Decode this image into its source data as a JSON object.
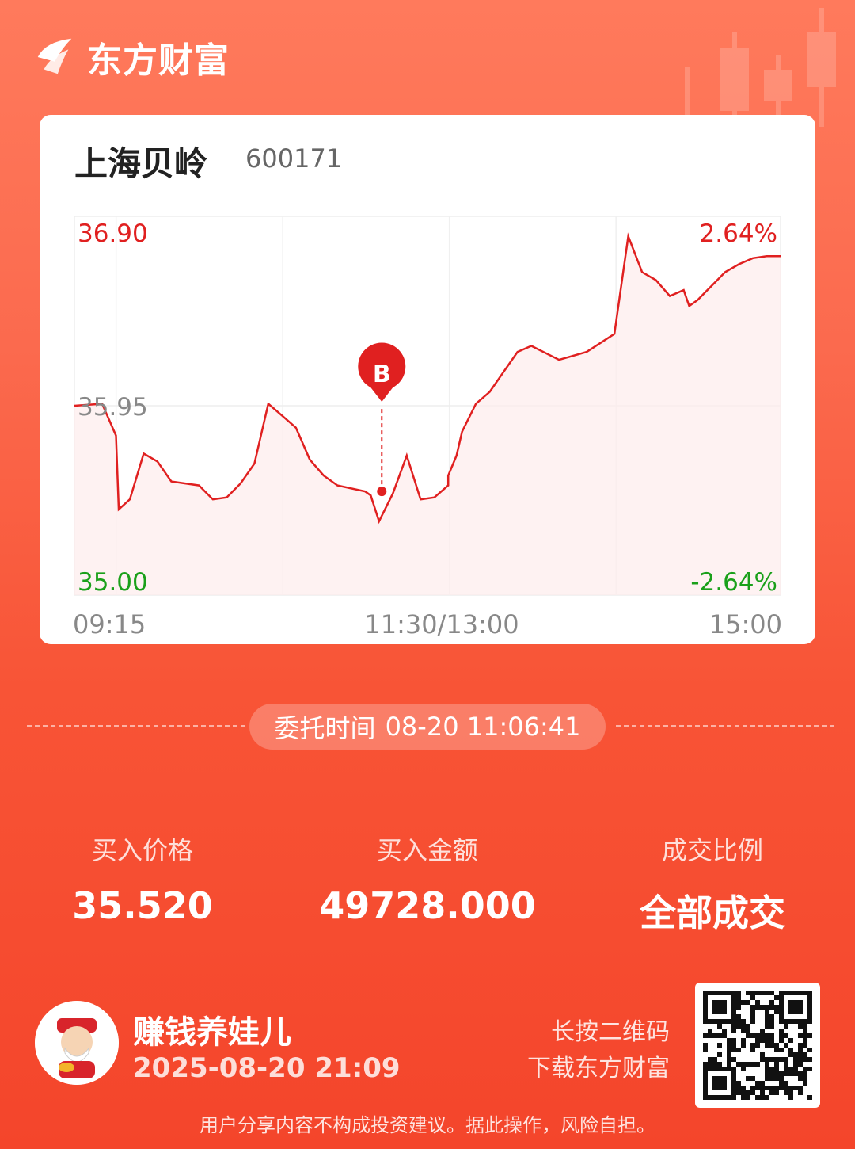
{
  "brand": {
    "name": "东方财富"
  },
  "stock": {
    "name": "上海贝岭",
    "code": "600171"
  },
  "chart_data": {
    "type": "line",
    "title": "",
    "x_tick_labels": [
      "09:15",
      "11:30/13:00",
      "15:00"
    ],
    "y_left_labels": [
      "36.90",
      "35.95",
      "35.00"
    ],
    "y_right_labels": [
      "2.64%",
      "-2.64%"
    ],
    "ylim": [
      35.0,
      36.9
    ],
    "reference_price": 35.95,
    "grid": true,
    "series": [
      {
        "x": [
          "09:15",
          "09:25",
          "09:30",
          "09:31",
          "09:35",
          "09:40",
          "09:45",
          "09:50",
          "10:00",
          "10:05",
          "10:10",
          "10:15",
          "10:20",
          "10:25",
          "10:30",
          "10:35",
          "10:40",
          "10:45",
          "10:50",
          "11:00",
          "11:02",
          "11:05",
          "11:10",
          "11:15",
          "11:20",
          "11:25",
          "11:30",
          "13:00",
          "13:03",
          "13:05",
          "13:10",
          "13:15",
          "13:20",
          "13:25",
          "13:30",
          "13:40",
          "13:50",
          "14:00",
          "14:05",
          "14:10",
          "14:15",
          "14:20",
          "14:25",
          "14:27",
          "14:30",
          "14:35",
          "14:40",
          "14:45",
          "14:50",
          "14:55",
          "15:00"
        ],
        "values": [
          35.95,
          35.96,
          35.8,
          35.43,
          35.48,
          35.71,
          35.67,
          35.57,
          35.55,
          35.48,
          35.49,
          35.56,
          35.66,
          35.96,
          35.9,
          35.84,
          35.68,
          35.6,
          35.55,
          35.52,
          35.5,
          35.37,
          35.51,
          35.7,
          35.48,
          35.49,
          35.55,
          35.6,
          35.7,
          35.82,
          35.96,
          36.02,
          36.12,
          36.22,
          36.25,
          36.18,
          36.22,
          36.31,
          36.8,
          36.62,
          36.58,
          36.5,
          36.53,
          36.45,
          36.48,
          36.55,
          36.62,
          36.66,
          36.69,
          36.7,
          36.7
        ]
      }
    ],
    "buy_marker": {
      "label": "B",
      "time": "11:06",
      "price": 35.52
    }
  },
  "order": {
    "time_label": "委托时间",
    "time_value": "08-20 11:06:41"
  },
  "stats": [
    {
      "label": "买入价格",
      "value": "35.520"
    },
    {
      "label": "买入金额",
      "value": "49728.000"
    },
    {
      "label": "成交比例",
      "value": "全部成交"
    }
  ],
  "user": {
    "name": "赚钱养娃儿",
    "datetime": "2025-08-20 21:09"
  },
  "qr_hint": {
    "line1": "长按二维码",
    "line2": "下载东方财富"
  },
  "disclaimer": "用户分享内容不构成投资建议。据此操作，风险自担。",
  "colors": {
    "up": "#e02020",
    "down": "#1aa01a",
    "neutral": "#888888"
  },
  "icons": {
    "logo": "eastmoney-logo-icon",
    "qr": "qr-code-icon",
    "avatar": "caishen-avatar-icon"
  }
}
